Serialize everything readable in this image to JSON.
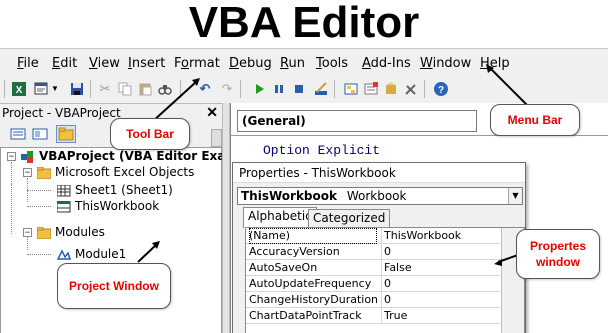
{
  "page_title": "VBA Editor",
  "menu": [
    {
      "label": "File",
      "ul": "F"
    },
    {
      "label": "Edit",
      "ul": "E"
    },
    {
      "label": "View",
      "ul": "V"
    },
    {
      "label": "Insert",
      "ul": "I"
    },
    {
      "label": "Format",
      "ul": "o"
    },
    {
      "label": "Debug",
      "ul": "D"
    },
    {
      "label": "Run",
      "ul": "R"
    },
    {
      "label": "Tools",
      "ul": "T"
    },
    {
      "label": "Add-Ins",
      "ul": "A"
    },
    {
      "label": "Window",
      "ul": "W"
    },
    {
      "label": "Help",
      "ul": "H"
    }
  ],
  "toolbar_icons": [
    "excel-icon",
    "insert-module-icon",
    "dropdown-icon",
    "save-icon",
    "cut-icon",
    "copy-icon",
    "paste-icon",
    "find-icon",
    "undo-icon",
    "redo-icon",
    "run-icon",
    "break-icon",
    "reset-icon",
    "design-mode-icon",
    "project-explorer-icon",
    "properties-icon",
    "object-browser-icon",
    "toolbox-icon",
    "help-icon"
  ],
  "project": {
    "title": "Project - VBAProject",
    "close_glyph": "✕",
    "tree": {
      "root": "VBAProject (VBA Editor Example",
      "excel_objects": "Microsoft Excel Objects",
      "sheet1": "Sheet1 (Sheet1)",
      "this_workbook": "ThisWorkbook",
      "modules": "Modules",
      "module1": "Module1"
    }
  },
  "code": {
    "object_combo": "(General)",
    "line1": "Option Explicit"
  },
  "properties": {
    "title": "Properties - ThisWorkbook",
    "object_name": "ThisWorkbook",
    "object_type": "Workbook",
    "tabs": [
      "Alphabetic",
      "Categorized"
    ],
    "rows": [
      {
        "name": "(Name)",
        "value": "ThisWorkbook"
      },
      {
        "name": "AccuracyVersion",
        "value": "0"
      },
      {
        "name": "AutoSaveOn",
        "value": "False"
      },
      {
        "name": "AutoUpdateFrequency",
        "value": "0"
      },
      {
        "name": "ChangeHistoryDuration",
        "value": "0"
      },
      {
        "name": "ChartDataPointTrack",
        "value": "True"
      }
    ]
  },
  "callouts": {
    "tool_bar": "Tool Bar",
    "menu_bar": "Menu Bar",
    "project_window": "Project Window",
    "properties_window_1": "Propertes",
    "properties_window_2": "window"
  },
  "colors": {
    "callout_text": "#e60000",
    "code_keyword": "#00007f",
    "run_green": "#1a9e1a",
    "excel_green": "#1d6f42"
  }
}
